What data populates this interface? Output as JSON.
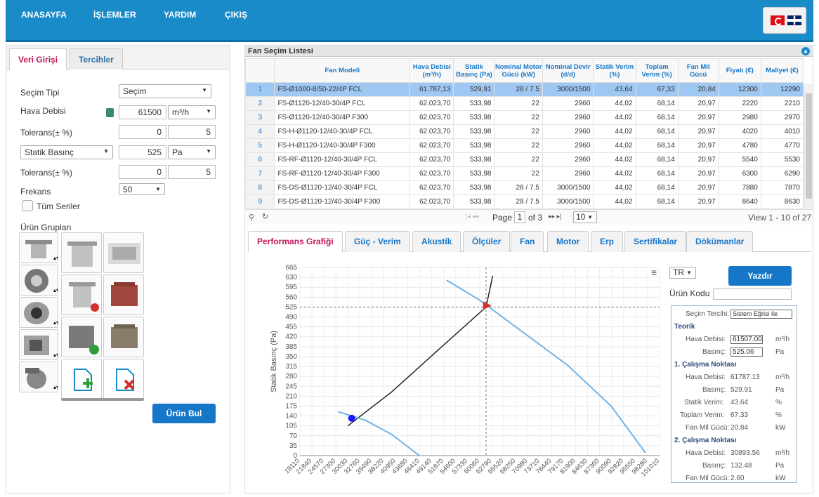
{
  "nav": {
    "items": [
      "ANASAYFA",
      "İŞLEMLER",
      "YARDIM",
      "ÇIKIŞ"
    ]
  },
  "left": {
    "tabs": [
      "Veri Girişi",
      "Tercihler"
    ],
    "secim_tipi_label": "Seçim Tipi",
    "secim_tipi_value": "Seçim",
    "hava_debisi_label": "Hava Debisi",
    "hava_debisi_value": "61500",
    "hava_unit": "m³/h",
    "tolerans_label": "Tolerans(± %)",
    "tol1_min": "0",
    "tol1_max": "5",
    "basinc_type": "Statik Basınç",
    "basinc_value": "525",
    "basinc_unit": "Pa",
    "tol2_min": "0",
    "tol2_max": "5",
    "frekans_label": "Frekans",
    "frekans_value": "50",
    "tum_seriler": "Tüm Seriler",
    "urun_gruplari": "Ürün Grupları",
    "urun_bul": "Ürün Bul"
  },
  "list": {
    "title": "Fan Seçim Listesi",
    "columns": [
      "",
      "Fan Modeli",
      "Hava Debisi (m³/h)",
      "Statik Basınç (Pa)",
      "Nominal Motor Gücü (kW)",
      "Nominal Devir (d/d)",
      "Statik Verim (%)",
      "Toplam Verim (%)",
      "Fan Mil Gücü",
      "Fiyatı (€)",
      "Maliyet (€)"
    ],
    "rows": [
      [
        "1",
        "FS-Ø1000-8/50-22/4P FCL",
        "61.787,13",
        "529,91",
        "28 / 7.5",
        "3000/1500",
        "43,64",
        "67,33",
        "20,84",
        "12300",
        "12290"
      ],
      [
        "2",
        "FS-Ø1120-12/40-30/4P FCL",
        "62.023,70",
        "533,98",
        "22",
        "2960",
        "44,02",
        "68,14",
        "20,97",
        "2220",
        "2210"
      ],
      [
        "3",
        "FS-Ø1120-12/40-30/4P F300",
        "62.023,70",
        "533,98",
        "22",
        "2960",
        "44,02",
        "68,14",
        "20,97",
        "2980",
        "2970"
      ],
      [
        "4",
        "FS-H-Ø1120-12/40-30/4P FCL",
        "62.023,70",
        "533,98",
        "22",
        "2960",
        "44,02",
        "68,14",
        "20,97",
        "4020",
        "4010"
      ],
      [
        "5",
        "FS-H-Ø1120-12/40-30/4P F300",
        "62.023,70",
        "533,98",
        "22",
        "2960",
        "44,02",
        "68,14",
        "20,97",
        "4780",
        "4770"
      ],
      [
        "6",
        "FS-RF-Ø1120-12/40-30/4P FCL",
        "62.023,70",
        "533,98",
        "22",
        "2960",
        "44,02",
        "68,14",
        "20,97",
        "5540",
        "5530"
      ],
      [
        "7",
        "FS-RF-Ø1120-12/40-30/4P F300",
        "62.023,70",
        "533,98",
        "22",
        "2960",
        "44,02",
        "68,14",
        "20,97",
        "6300",
        "6290"
      ],
      [
        "8",
        "FS-DS-Ø1120-12/40-30/4P FCL",
        "62.023,70",
        "533,98",
        "28 / 7.5",
        "3000/1500",
        "44,02",
        "68,14",
        "20,97",
        "7880",
        "7870"
      ],
      [
        "9",
        "FS-DS-Ø1120-12/40-30/4P F300",
        "62.023,70",
        "533,98",
        "28 / 7.5",
        "3000/1500",
        "44,02",
        "68,14",
        "20,97",
        "8640",
        "8630"
      ]
    ],
    "pager": {
      "page_label": "Page",
      "page": "1",
      "of": "of 3",
      "per_page": "10",
      "view": "View 1 - 10 of 27"
    }
  },
  "tabs": [
    "Performans Grafiği",
    "Güç - Verim",
    "Akustik",
    "Ölçüler",
    "Fan",
    "Motor",
    "Erp",
    "Sertifikalar",
    "Dökümanlar"
  ],
  "chart_data": {
    "type": "line",
    "ylabel": "Statik Basınç (Pa)",
    "yticks": [
      0,
      35,
      70,
      105,
      140,
      175,
      210,
      245,
      280,
      315,
      350,
      385,
      420,
      455,
      490,
      525,
      560,
      595,
      630,
      665
    ],
    "xticks": [
      19110,
      21840,
      24570,
      27300,
      30030,
      32760,
      35490,
      38220,
      40950,
      43680,
      46410,
      49140,
      51870,
      54600,
      57330,
      60060,
      62790,
      65520,
      68250,
      70980,
      73710,
      76440,
      79170,
      81900,
      84630,
      87360,
      90090,
      92820,
      95550,
      98280,
      101010
    ],
    "series": [
      {
        "x": [
          30000,
          40000,
          50000,
          61500,
          63000
        ],
        "y": [
          105,
          225,
          365,
          525,
          635
        ]
      },
      {
        "x": [
          27800,
          34000,
          40000,
          46300
        ],
        "y": [
          155,
          125,
          75,
          0
        ]
      },
      {
        "x": [
          52500,
          60000,
          70000,
          80000,
          90000,
          97800
        ],
        "y": [
          620,
          550,
          435,
          320,
          175,
          10
        ]
      }
    ],
    "operating_points": [
      {
        "x": 61787,
        "y": 530
      },
      {
        "x": 30894,
        "y": 132
      }
    ],
    "crosshair": {
      "x": 61500,
      "y": 525
    }
  },
  "panel": {
    "lang": "TR",
    "print": "Yazdır",
    "urun_kodu": "Ürün Kodu",
    "secim_tercihi_label": "Seçim Tercihi:",
    "secim_tercihi_value": "Sistem Eğrisi ile",
    "teorik": "Teorik",
    "hava_debisi": "Hava Debisi:",
    "basinc": "Basınç:",
    "statik_verim": "Statik Verim:",
    "toplam_verim": "Toplam Verim:",
    "fan_mil": "Fan Mil Gücü:",
    "t_hava": "61507.00",
    "t_basinc": "525.06",
    "unit_flow": "m³/h",
    "unit_pa": "Pa",
    "unit_pct": "%",
    "unit_kw": "kW",
    "n1_title": "1. Çalışma Noktası",
    "n1_hava": "61787.13",
    "n1_basinc": "529.91",
    "n1_sv": "43.64",
    "n1_tv": "67.33",
    "n1_fm": "20.84",
    "n2_title": "2. Çalışma Noktası",
    "n2_hava": "30893.56",
    "n2_basinc": "132.48",
    "n2_fm": "2.60"
  }
}
